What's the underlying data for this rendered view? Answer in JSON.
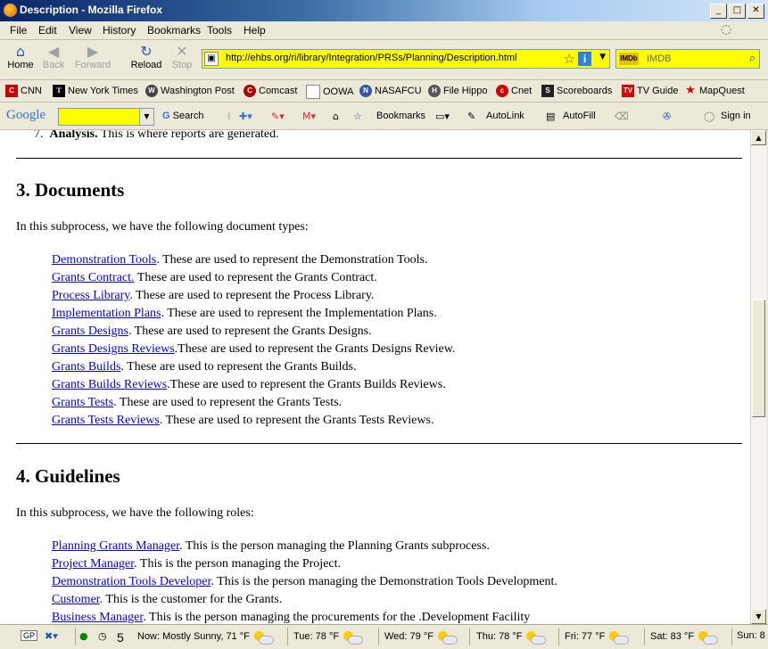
{
  "window": {
    "title": "Description - Mozilla Firefox"
  },
  "menu": [
    "File",
    "Edit",
    "View",
    "History",
    "Bookmarks",
    "Tools",
    "Help"
  ],
  "nav": {
    "home": "Home",
    "back": "Back",
    "forward": "Forward",
    "reload": "Reload",
    "stop": "Stop"
  },
  "url": "http://ehbs.org/ri/library/Integration/PRSs/Planning/Description.html",
  "search": {
    "engine_label": "IMDb",
    "placeholder": "IMDB"
  },
  "bookmarks": [
    "CNN",
    "New York Times",
    "Washington Post",
    "Comcast",
    "OOWA",
    "NASAFCU",
    "File Hippo",
    "Cnet",
    "Scoreboards",
    "TV Guide",
    "MapQuest"
  ],
  "google_bar": {
    "logo": "Google",
    "search": "Search",
    "bookmarks": "Bookmarks",
    "autolink": "AutoLink",
    "autofill": "AutoFill",
    "signin": "Sign in"
  },
  "content": {
    "prev_item_number": "7.",
    "prev_item_bold": "Analysis.",
    "prev_item_text": " This is where reports are generated.",
    "section3": {
      "title": "3. Documents",
      "intro": "In this subprocess, we have the following document types:",
      "items": [
        {
          "link": "Demonstration Tools",
          "text": ". These are used to represent the Demonstration Tools."
        },
        {
          "link": "Grants Contract.",
          "text": " These are used to represent the Grants Contract."
        },
        {
          "link": "Process Library",
          "text": ". These are used to represent the Process Library."
        },
        {
          "link": "Implementation Plans",
          "text": ". These are used to represent the Implementation Plans."
        },
        {
          "link": "Grants Designs",
          "text": ". These are used to represent the Grants Designs."
        },
        {
          "link": "Grants Designs Reviews",
          "text": ".These are used to represent the Grants Designs Review."
        },
        {
          "link": "Grants Builds",
          "text": ". These are used to represent the Grants Builds."
        },
        {
          "link": "Grants Builds Reviews",
          "text": ".These are used to represent the Grants Builds Reviews."
        },
        {
          "link": "Grants Tests",
          "text": ". These are used to represent the Grants Tests."
        },
        {
          "link": "Grants Tests Reviews",
          "text": ". These are used to represent the Grants Tests Reviews."
        }
      ]
    },
    "section4": {
      "title": "4. Guidelines",
      "intro": "In this subprocess, we have the following roles:",
      "items": [
        {
          "link": "Planning Grants Manager",
          "text": ". This is the person managing the Planning Grants subprocess."
        },
        {
          "link": "Project Manager",
          "text": ". This is the person managing the Project."
        },
        {
          "link": "Demonstration Tools Developer",
          "text": ". This is the person managing the Demonstration Tools Development."
        },
        {
          "link": "Customer",
          "text": ". This is the customer for the Grants."
        },
        {
          "link": "Business Manager",
          "text": ". This is the person managing the procurements for the .Development Facility"
        }
      ]
    }
  },
  "status": {
    "gp": "GP",
    "count": "5",
    "weather": [
      "Now: Mostly Sunny, 71 °F",
      "Tue: 78 °F",
      "Wed: 79 °F",
      "Thu: 78 °F",
      "Fri: 77 °F",
      "Sat: 83 °F",
      "Sun: 8"
    ]
  }
}
